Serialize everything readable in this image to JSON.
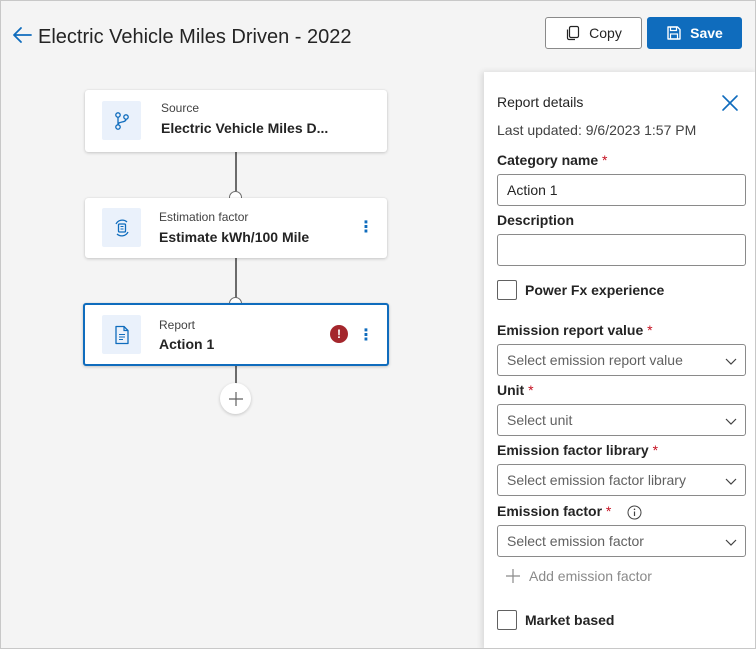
{
  "header": {
    "title": "Electric Vehicle Miles Driven - 2022",
    "copy_label": "Copy",
    "save_label": "Save"
  },
  "flow": {
    "nodes": [
      {
        "type_label": "Source",
        "name": "Electric Vehicle Miles D...",
        "icon": "branch-icon"
      },
      {
        "type_label": "Estimation factor",
        "name": "Estimate kWh/100 Mile",
        "icon": "estimation-icon"
      },
      {
        "type_label": "Report",
        "name": "Action 1",
        "icon": "document-icon",
        "error": "!"
      }
    ],
    "more_glyph": "⋮"
  },
  "panel": {
    "title": "Report details",
    "last_updated": "Last updated: 9/6/2023 1:57 PM",
    "category_label": "Category name",
    "category_value": "Action 1",
    "description_label": "Description",
    "description_value": "",
    "powerfx_label": "Power Fx experience",
    "emission_report_value_label": "Emission report value",
    "emission_report_value_placeholder": "Select emission report value",
    "unit_label": "Unit",
    "unit_placeholder": "Select unit",
    "emission_factor_library_label": "Emission factor library",
    "emission_factor_library_placeholder": "Select emission factor library",
    "emission_factor_label": "Emission factor",
    "emission_factor_placeholder": "Select emission factor",
    "add_emission_factor_label": "Add emission factor",
    "market_based_label": "Market based",
    "required_mark": "*"
  },
  "colors": {
    "accent": "#0f6cbd",
    "error": "#a4262c",
    "icon_bg": "#eaf1fb"
  }
}
